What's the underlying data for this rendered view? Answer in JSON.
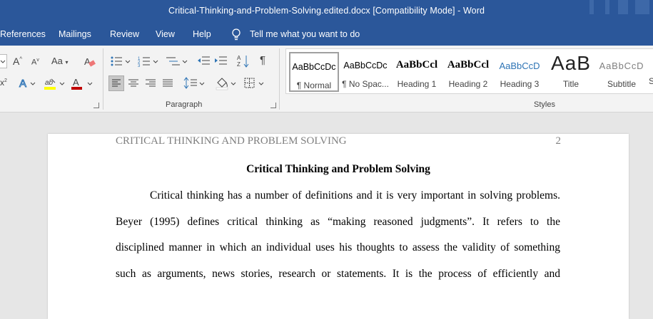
{
  "window": {
    "title": "Critical-Thinking-and-Problem-Solving.edited.docx [Compatibility Mode]  -  Word"
  },
  "tabs": [
    "References",
    "Mailings",
    "Review",
    "View",
    "Help"
  ],
  "tell_me": "Tell me what you want to do",
  "ribbon": {
    "font": {
      "grow": "A",
      "shrink": "A",
      "case": "Aa"
    },
    "paragraph_label": "Paragraph",
    "styles_label": "Styles",
    "styles": [
      {
        "sample": "AaBbCcDc",
        "name": "¶ Normal"
      },
      {
        "sample": "AaBbCcDc",
        "name": "¶ No Spac..."
      },
      {
        "sample": "AaBbCcl",
        "name": "Heading 1"
      },
      {
        "sample": "AaBbCcl",
        "name": "Heading 2"
      },
      {
        "sample": "AaBbCcD",
        "name": "Heading 3"
      },
      {
        "sample": "AaB",
        "name": "Title"
      },
      {
        "sample": "AaBbCcD",
        "name": "Subtitle"
      }
    ]
  },
  "document": {
    "header_text": "CRITICAL THINKING AND PROBLEM SOLVING",
    "page_number": "2",
    "title": "Critical Thinking and Problem Solving",
    "lines": [
      "Critical thinking has a number of definitions and it is very important in solving problems.",
      "Beyer (1995) defines critical thinking as “making reasoned judgments”. It refers to the",
      "disciplined manner in which an individual uses his thoughts to assess the validity of something",
      "such as arguments, news stories, research or statements. It is the process of efficiently and"
    ]
  },
  "colors": {
    "title_bar": "#2b579a",
    "ribbon": "#f3f3f3",
    "canvas": "#e6e6e6",
    "font_color_red": "#c00000",
    "highlight_yellow": "#ffff00"
  }
}
